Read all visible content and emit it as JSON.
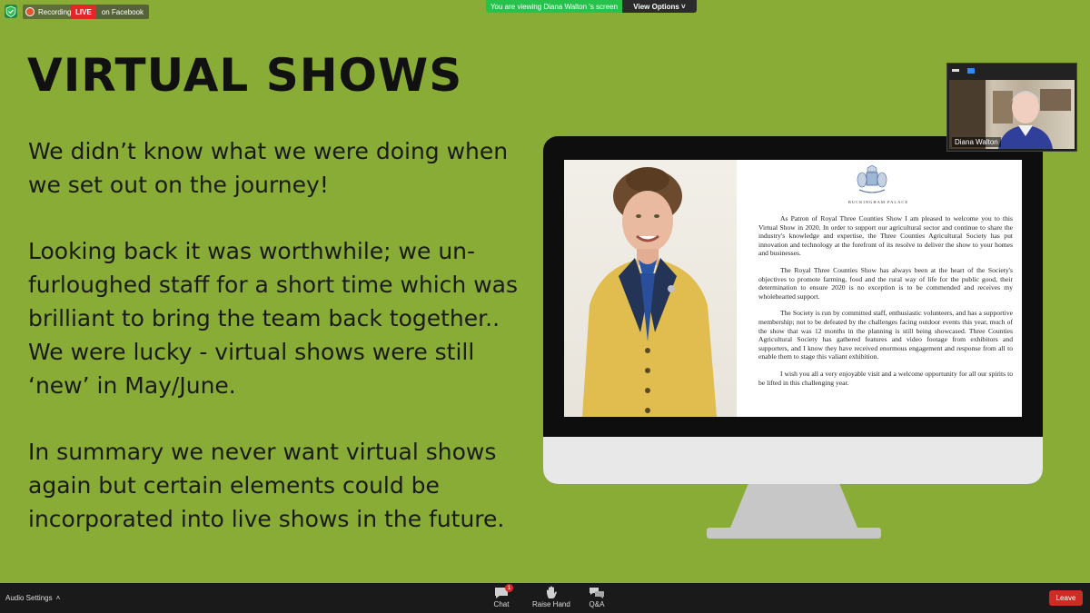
{
  "status_bar": {
    "recording_label": "Recording",
    "live_label": "LIVE",
    "live_destination": "on Facebook",
    "viewing_notice": "You are viewing Diana Walton 's screen",
    "view_options_label": "View Options ˅"
  },
  "slide": {
    "title": "VIRTUAL SHOWS",
    "paragraphs": [
      "We didn’t know what we were doing when we set out on the journey!",
      "Looking back it was worthwhile; we un-furloughed staff for a short time which was brilliant to bring the team back together.. We were lucky - virtual shows were still ‘new’  in May/June.",
      "In summary we never want virtual shows again but certain elements could be incorporated into live shows in the future."
    ],
    "letter": {
      "heading": "BUCKINGHAM PALACE",
      "paragraphs": [
        "As Patron of Royal Three Counties Show I am pleased to welcome you to this Virtual Show in 2020.  In order to support our agricultural sector and continue to share the industry's knowledge and expertise, the Three Counties Agricultural Society has put innovation and technology at the forefront of its resolve to deliver the show to your homes and businesses.",
        "The Royal Three Counties Show has always been at the heart of the Society's objectives to promote farming, food and the rural way of life for the public good, their determination to ensure 2020 is no exception is to be commended and receives my wholehearted support.",
        "The Society is run by committed staff, enthusiastic volunteers, and has a supportive membership; not to be defeated by the challenges facing outdoor events this year, much of the show that was 12 months in the planning is still being showcased.  Three Counties Agricultural Society has gathered features and video footage from exhibitors and supporters, and I know they have received enormous engagement and response from all to enable them to stage this valiant exhibition.",
        "I wish you all a very enjoyable visit and a welcome opportunity for all our spirits to be lifted in this challenging year."
      ]
    }
  },
  "participant": {
    "name": "Diana Walton"
  },
  "toolbar": {
    "audio_settings_label": "Audio Settings",
    "audio_settings_chevron": "˄",
    "chat_label": "Chat",
    "chat_badge": "1",
    "raise_hand_label": "Raise Hand",
    "qa_label": "Q&A",
    "leave_label": "Leave"
  },
  "colors": {
    "slide_background": "#88ac36",
    "live_red": "#e02828",
    "viewing_green": "#27c24c",
    "leave_red": "#cf2b25"
  },
  "icons": [
    "shield-icon",
    "recording-dot-icon",
    "chat-icon",
    "raise-hand-icon",
    "qa-icon",
    "chevron-up-icon"
  ]
}
